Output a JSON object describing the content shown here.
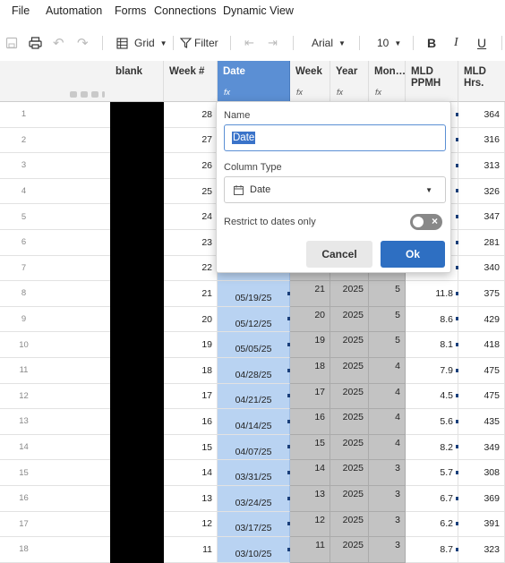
{
  "menu": [
    "File",
    "Automation",
    "Forms",
    "Connections",
    "Dynamic View"
  ],
  "toolbar": {
    "view_label": "Grid",
    "filter_label": "Filter",
    "font_name": "Arial",
    "font_size": "10",
    "bold": "B",
    "italic": "I",
    "underline": "U"
  },
  "columns": {
    "blank": "blank",
    "week": "Week #",
    "date": "Date",
    "week2": "Week",
    "year": "Year",
    "month": "Mon…",
    "ppmh": "MLD PPMH",
    "hrs": "MLD Hrs.",
    "fx": "fx"
  },
  "rows": [
    {
      "n": "1",
      "week": "28",
      "date": "",
      "wk": "",
      "year": "",
      "mon": "",
      "ppmh": "",
      "hrs": "364"
    },
    {
      "n": "2",
      "week": "27",
      "date": "",
      "wk": "",
      "year": "",
      "mon": "",
      "ppmh": "",
      "hrs": "316"
    },
    {
      "n": "3",
      "week": "26",
      "date": "",
      "wk": "",
      "year": "",
      "mon": "",
      "ppmh": "",
      "hrs": "313"
    },
    {
      "n": "4",
      "week": "25",
      "date": "",
      "wk": "",
      "year": "",
      "mon": "",
      "ppmh": "",
      "hrs": "326"
    },
    {
      "n": "5",
      "week": "24",
      "date": "",
      "wk": "",
      "year": "",
      "mon": "",
      "ppmh": "",
      "hrs": "347"
    },
    {
      "n": "6",
      "week": "23",
      "date": "",
      "wk": "",
      "year": "",
      "mon": "",
      "ppmh": "",
      "hrs": "281"
    },
    {
      "n": "7",
      "week": "22",
      "date": "",
      "wk": "",
      "year": "",
      "mon": "",
      "ppmh": "",
      "hrs": "340"
    },
    {
      "n": "8",
      "week": "21",
      "date": "05/19/25",
      "wk": "21",
      "year": "2025",
      "mon": "5",
      "ppmh": "11.8",
      "hrs": "375"
    },
    {
      "n": "9",
      "week": "20",
      "date": "05/12/25",
      "wk": "20",
      "year": "2025",
      "mon": "5",
      "ppmh": "8.6",
      "hrs": "429"
    },
    {
      "n": "10",
      "week": "19",
      "date": "05/05/25",
      "wk": "19",
      "year": "2025",
      "mon": "5",
      "ppmh": "8.1",
      "hrs": "418"
    },
    {
      "n": "11",
      "week": "18",
      "date": "04/28/25",
      "wk": "18",
      "year": "2025",
      "mon": "4",
      "ppmh": "7.9",
      "hrs": "475"
    },
    {
      "n": "12",
      "week": "17",
      "date": "04/21/25",
      "wk": "17",
      "year": "2025",
      "mon": "4",
      "ppmh": "4.5",
      "hrs": "475"
    },
    {
      "n": "13",
      "week": "16",
      "date": "04/14/25",
      "wk": "16",
      "year": "2025",
      "mon": "4",
      "ppmh": "5.6",
      "hrs": "435"
    },
    {
      "n": "14",
      "week": "15",
      "date": "04/07/25",
      "wk": "15",
      "year": "2025",
      "mon": "4",
      "ppmh": "8.2",
      "hrs": "349"
    },
    {
      "n": "15",
      "week": "14",
      "date": "03/31/25",
      "wk": "14",
      "year": "2025",
      "mon": "3",
      "ppmh": "5.7",
      "hrs": "308"
    },
    {
      "n": "16",
      "week": "13",
      "date": "03/24/25",
      "wk": "13",
      "year": "2025",
      "mon": "3",
      "ppmh": "6.7",
      "hrs": "369"
    },
    {
      "n": "17",
      "week": "12",
      "date": "03/17/25",
      "wk": "12",
      "year": "2025",
      "mon": "3",
      "ppmh": "6.2",
      "hrs": "391"
    },
    {
      "n": "18",
      "week": "11",
      "date": "03/10/25",
      "wk": "11",
      "year": "2025",
      "mon": "3",
      "ppmh": "8.7",
      "hrs": "323"
    }
  ],
  "dialog": {
    "name_label": "Name",
    "name_value": "Date",
    "type_label": "Column Type",
    "type_value": "Date",
    "restrict_label": "Restrict to dates only",
    "restrict_on": false,
    "cancel": "Cancel",
    "ok": "Ok"
  },
  "colors": {
    "selected_header": "#5b8fd4",
    "selected_column": "#b9d3f2",
    "ok_button": "#2e6fc2",
    "formula_cells": "#c3c3c3"
  }
}
